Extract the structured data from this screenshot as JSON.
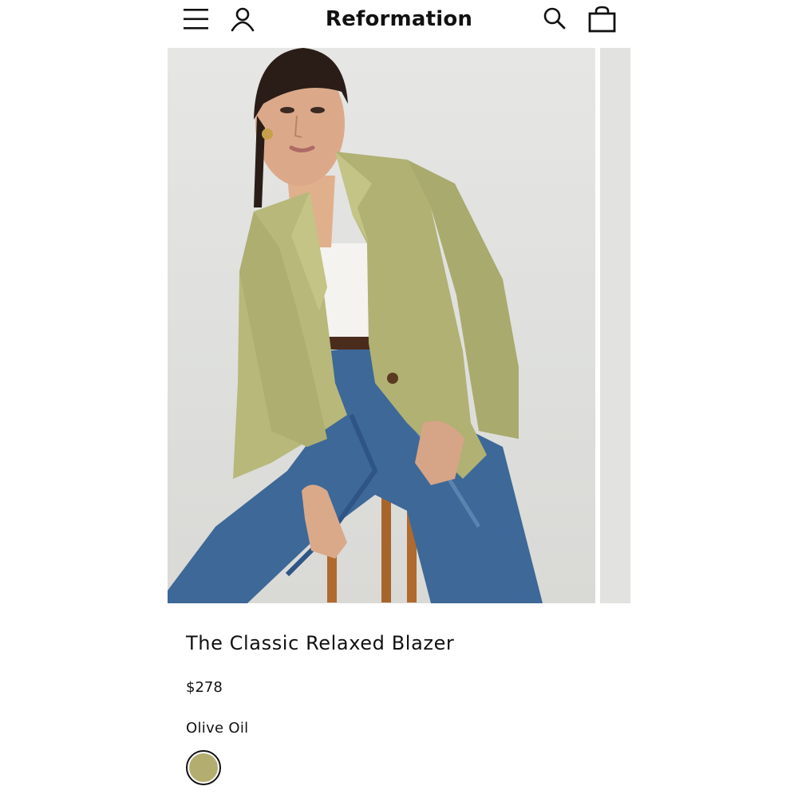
{
  "header": {
    "brand": "Reformation",
    "menu_icon": "hamburger-menu-icon",
    "account_icon": "person-icon",
    "search_icon": "magnifier-icon",
    "bag_icon": "shopping-bag-icon"
  },
  "gallery": {
    "slides": [
      "model wearing olive blazer and jeans",
      "next product image"
    ]
  },
  "product": {
    "name": "The Classic Relaxed Blazer",
    "price": "$278",
    "color_name": "Olive Oil",
    "swatch_color": "#b3ad70"
  },
  "colors": {
    "blazer": "#b7b87a",
    "jeans": "#3a6596",
    "background": "#e3e3e1"
  }
}
